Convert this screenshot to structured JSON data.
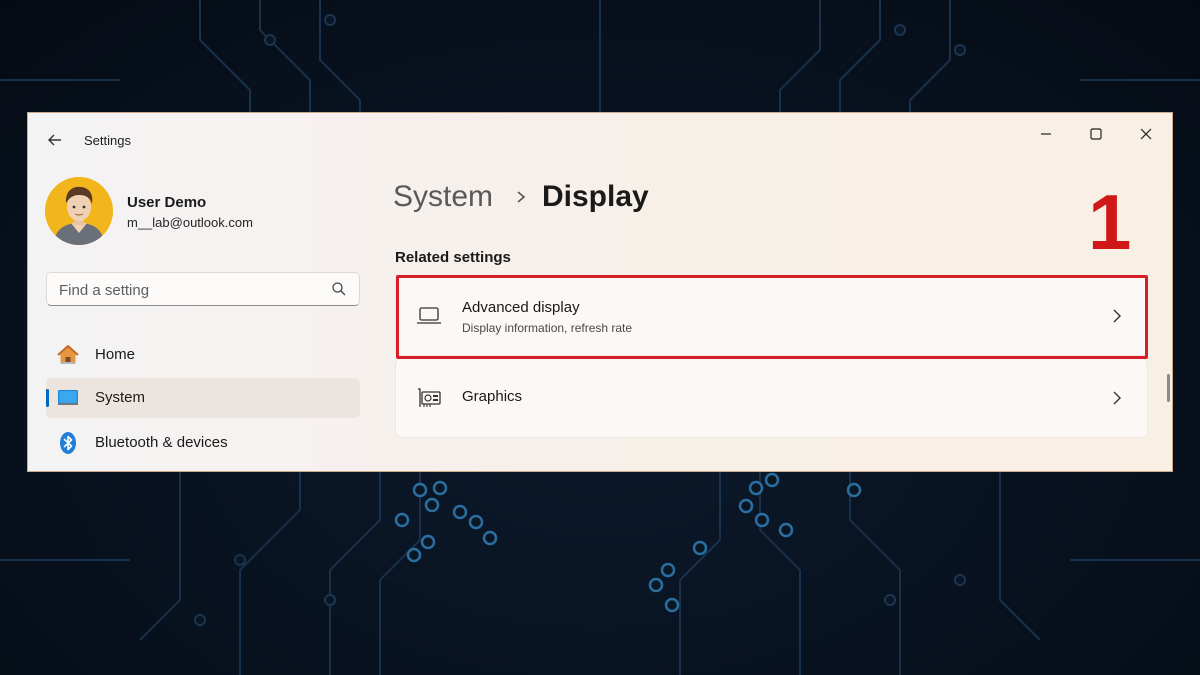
{
  "window": {
    "title": "Settings",
    "controls": {
      "minimize": "minimize-icon",
      "maximize": "maximize-icon",
      "close": "close-icon"
    }
  },
  "user": {
    "name": "User Demo",
    "email": "m__lab@outlook.com",
    "avatar_color": "#f2b51c"
  },
  "search": {
    "placeholder": "Find a setting",
    "value": ""
  },
  "nav": {
    "items": [
      {
        "label": "Home",
        "icon": "home-icon",
        "selected": false
      },
      {
        "label": "System",
        "icon": "monitor-icon",
        "selected": true
      },
      {
        "label": "Bluetooth & devices",
        "icon": "bluetooth-icon",
        "selected": false
      }
    ]
  },
  "breadcrumb": {
    "parent": "System",
    "current": "Display"
  },
  "annotation": {
    "step": "1",
    "color": "#d61f26"
  },
  "related": {
    "heading": "Related settings",
    "cards": [
      {
        "title": "Advanced display",
        "subtitle": "Display information, refresh rate",
        "icon": "laptop-icon",
        "highlighted": true
      },
      {
        "title": "Graphics",
        "subtitle": "",
        "icon": "graphics-card-icon",
        "highlighted": false
      }
    ]
  },
  "colors": {
    "accent": "#0067c0",
    "highlight": "#d61f26"
  }
}
